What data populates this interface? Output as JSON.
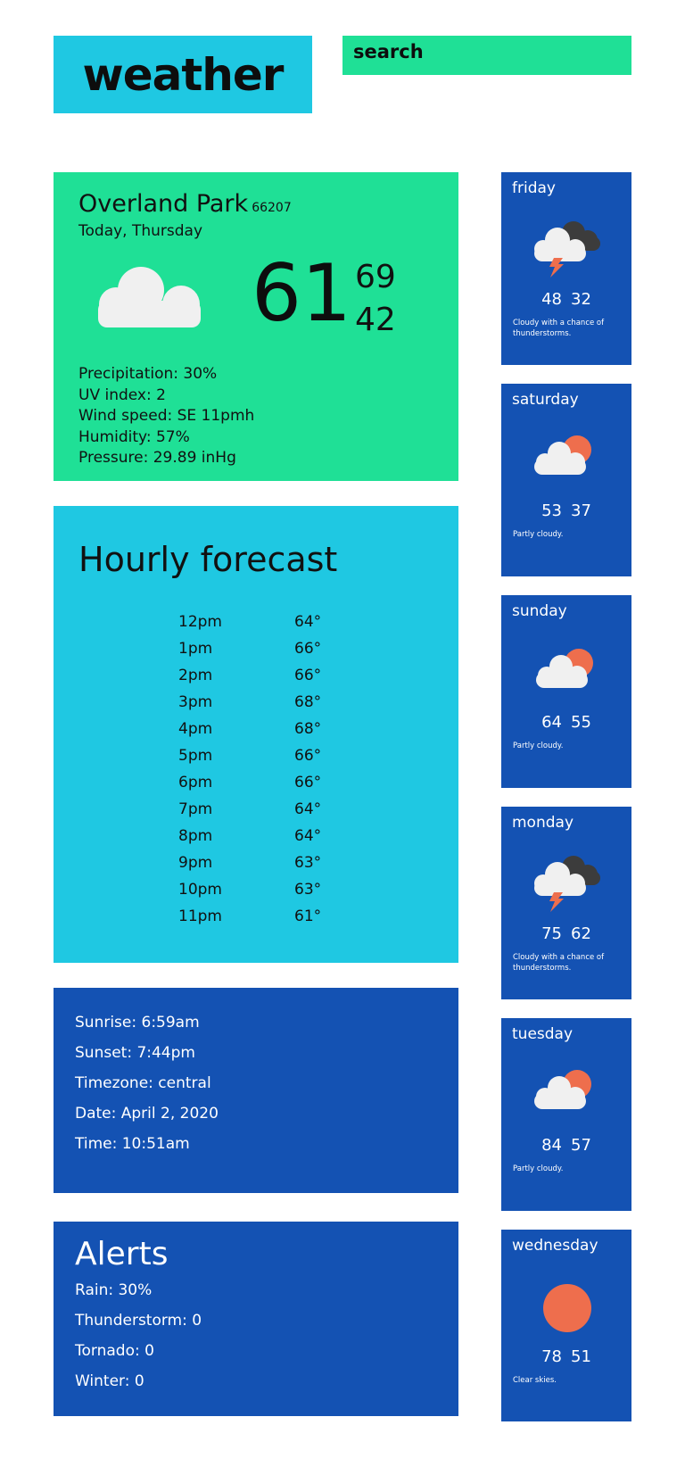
{
  "header": {
    "logo": "weather",
    "search_label": "search"
  },
  "current": {
    "city": "Overland Park",
    "zip": "66207",
    "day": "Today, Thursday",
    "temp": "61",
    "high": "69",
    "low": "42",
    "icon": "cloud-icon",
    "stats": [
      "Precipitation:  30%",
      "UV index:  2",
      "Wind speed:  SE 11pmh",
      "Humidity:   57%",
      "Pressure:  29.89 inHg"
    ]
  },
  "hourly": {
    "title": "Hourly forecast",
    "rows": [
      {
        "time": "12pm",
        "temp": "64°"
      },
      {
        "time": "1pm",
        "temp": "66°"
      },
      {
        "time": "2pm",
        "temp": "66°"
      },
      {
        "time": "3pm",
        "temp": "68°"
      },
      {
        "time": "4pm",
        "temp": "68°"
      },
      {
        "time": "5pm",
        "temp": "66°"
      },
      {
        "time": "6pm",
        "temp": "66°"
      },
      {
        "time": "7pm",
        "temp": "64°"
      },
      {
        "time": "8pm",
        "temp": "64°"
      },
      {
        "time": "9pm",
        "temp": "63°"
      },
      {
        "time": "10pm",
        "temp": "63°"
      },
      {
        "time": "11pm",
        "temp": "61°"
      }
    ]
  },
  "sun": [
    "Sunrise:  6:59am",
    "Sunset:  7:44pm",
    "Timezone:  central",
    "Date:  April 2, 2020",
    "Time:  10:51am"
  ],
  "alerts": {
    "title": "Alerts",
    "rows": [
      "Rain:  30%",
      "Thunderstorm:  0",
      "Tornado:  0",
      "Winter:  0"
    ]
  },
  "days": [
    {
      "name": "friday",
      "icon": "thunderstorm-icon",
      "high": "48",
      "low": "32",
      "desc": "Cloudy with a chance of thunderstorms."
    },
    {
      "name": "saturday",
      "icon": "partly-cloudy-icon",
      "high": "53",
      "low": "37",
      "desc": "Partly cloudy."
    },
    {
      "name": "sunday",
      "icon": "partly-cloudy-icon",
      "high": "64",
      "low": "55",
      "desc": "Partly cloudy."
    },
    {
      "name": "monday",
      "icon": "thunderstorm-icon",
      "high": "75",
      "low": "62",
      "desc": "Cloudy with a chance of thunderstorms."
    },
    {
      "name": "tuesday",
      "icon": "partly-cloudy-icon",
      "high": "84",
      "low": "57",
      "desc": "Partly cloudy."
    },
    {
      "name": "wednesday",
      "icon": "sun-icon",
      "high": "78",
      "low": "51",
      "desc": "Clear skies."
    }
  ],
  "colors": {
    "cyan": "#1fc8e2",
    "green": "#1fe096",
    "blue": "#1452b3",
    "sun": "#ee6e4d",
    "cloud": "#f0f0f0",
    "dark_cloud": "#3c3c3c"
  }
}
